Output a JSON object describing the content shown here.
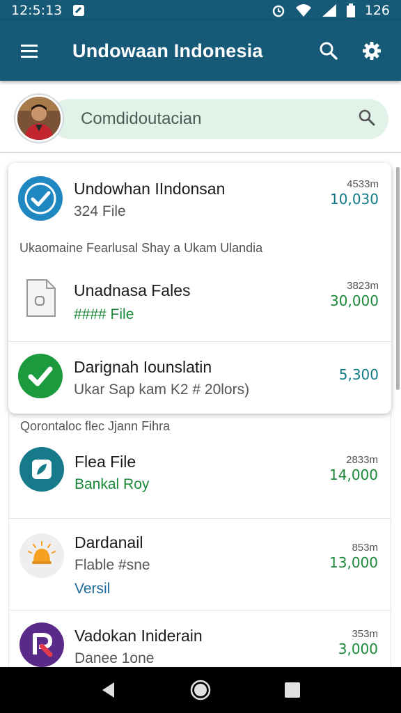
{
  "status_bar": {
    "time": "12:5:13",
    "battery_text": "126",
    "icons": [
      "notification-icon",
      "alarm-icon",
      "wifi-icon",
      "signal-icon",
      "battery-icon"
    ]
  },
  "app_bar": {
    "title": "Undowaan Indonesia",
    "color": "#165a78",
    "icons": [
      "menu-icon",
      "search-icon",
      "settings-icon"
    ]
  },
  "search": {
    "value": "Comdidoutacian",
    "bg_color": "#e1f2e9"
  },
  "card": {
    "caption": "Ukaomaine Fearlusal Shay a Ukam Ulandia",
    "items": [
      {
        "title": "Undowhan IIndonsan",
        "subtitle": "324 File",
        "small": "4533m",
        "value": "10,030",
        "icon": "check-badge-icon"
      },
      {
        "title": "Unadnasa Fales",
        "subtitle": "#### File",
        "small": "3823m",
        "value": "30,000",
        "icon": "file-icon"
      },
      {
        "title": "Darignah Iounslatin",
        "subtitle": "Ukar Sap kam K2 # 20lors)",
        "value": "5,300",
        "icon": "check-circle-icon"
      }
    ]
  },
  "list": {
    "caption": "Qorontaloc flec Jjann Fihra",
    "items": [
      {
        "title": "Flea File",
        "subtitle": "Bankal Roy",
        "small": "2833m",
        "value": "14,000",
        "icon": "leaf-app-icon"
      },
      {
        "title": "Dardanail",
        "subtitle": "Flable #sne",
        "extra": "Versil",
        "small": "853m",
        "value": "13,000",
        "icon": "bell-app-icon"
      },
      {
        "title": "Vadokan Iniderain",
        "subtitle": "Danee 1one",
        "small": "353m",
        "value": "3,000",
        "icon": "r-app-icon"
      }
    ]
  },
  "nav": {
    "icons": [
      "back-icon",
      "home-icon",
      "recents-icon"
    ]
  }
}
